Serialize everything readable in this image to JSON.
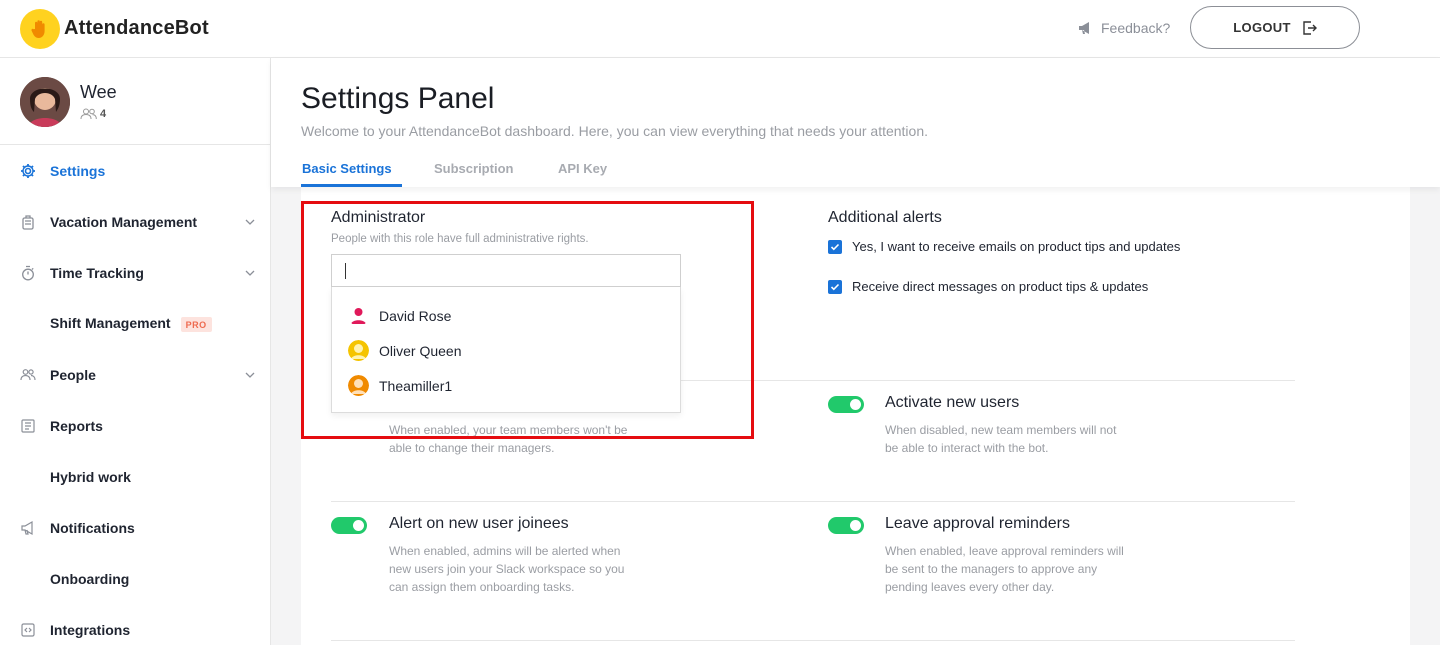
{
  "app": {
    "brand": "AttendanceBot"
  },
  "header": {
    "feedback_label": "Feedback?",
    "logout_label": "LOGOUT"
  },
  "user": {
    "name": "Wee",
    "member_count": "4"
  },
  "sidebar": {
    "items": [
      {
        "label": "Settings",
        "icon": "gear-icon",
        "active": true
      },
      {
        "label": "Vacation Management",
        "icon": "suitcase-icon",
        "expandable": true
      },
      {
        "label": "Time Tracking",
        "icon": "stopwatch-icon",
        "expandable": true
      },
      {
        "label": "Shift Management",
        "badge": "PRO"
      },
      {
        "label": "People",
        "icon": "people-icon",
        "expandable": true
      },
      {
        "label": "Reports",
        "icon": "reports-icon"
      },
      {
        "label": "Hybrid work"
      },
      {
        "label": "Notifications",
        "icon": "megaphone-icon"
      },
      {
        "label": "Onboarding"
      },
      {
        "label": "Integrations",
        "icon": "code-icon"
      }
    ]
  },
  "page": {
    "title": "Settings Panel",
    "subtitle": "Welcome to your AttendanceBot dashboard. Here, you can view everything that needs your attention.",
    "tabs": [
      {
        "label": "Basic Settings",
        "active": true
      },
      {
        "label": "Subscription"
      },
      {
        "label": "API Key"
      }
    ]
  },
  "administrator": {
    "title": "Administrator",
    "description": "People with this role have full administrative rights.",
    "input_value": "",
    "options": [
      {
        "name": "David Rose",
        "avatar_color": "#e0195a"
      },
      {
        "name": "Oliver Queen",
        "avatar_color": "#f5c400"
      },
      {
        "name": "Theamiller1",
        "avatar_color": "#f08a00"
      }
    ]
  },
  "alerts": {
    "title": "Additional alerts",
    "options": [
      {
        "label": "Yes, I want to receive emails on product tips and updates",
        "checked": true
      },
      {
        "label": "Receive direct messages on product tips & updates",
        "checked": true
      }
    ]
  },
  "settings": [
    {
      "title": "",
      "description": "When enabled, your team members won't be able to change their managers.",
      "enabled": true
    },
    {
      "title": "Activate new users",
      "description": "When disabled, new team members will not be able to interact with the bot.",
      "enabled": true
    },
    {
      "title": "Alert on new user joinees",
      "description": "When enabled, admins will be alerted when new users join your Slack workspace so you can assign them onboarding tasks.",
      "enabled": true
    },
    {
      "title": "Leave approval reminders",
      "description": "When enabled, leave approval reminders will be sent to the managers to approve any pending leaves every other day.",
      "enabled": true
    }
  ],
  "colors": {
    "accent": "#1a73d8",
    "toggle_on": "#21c96b",
    "highlight": "#e50c10",
    "logo": "#ffd21f"
  }
}
